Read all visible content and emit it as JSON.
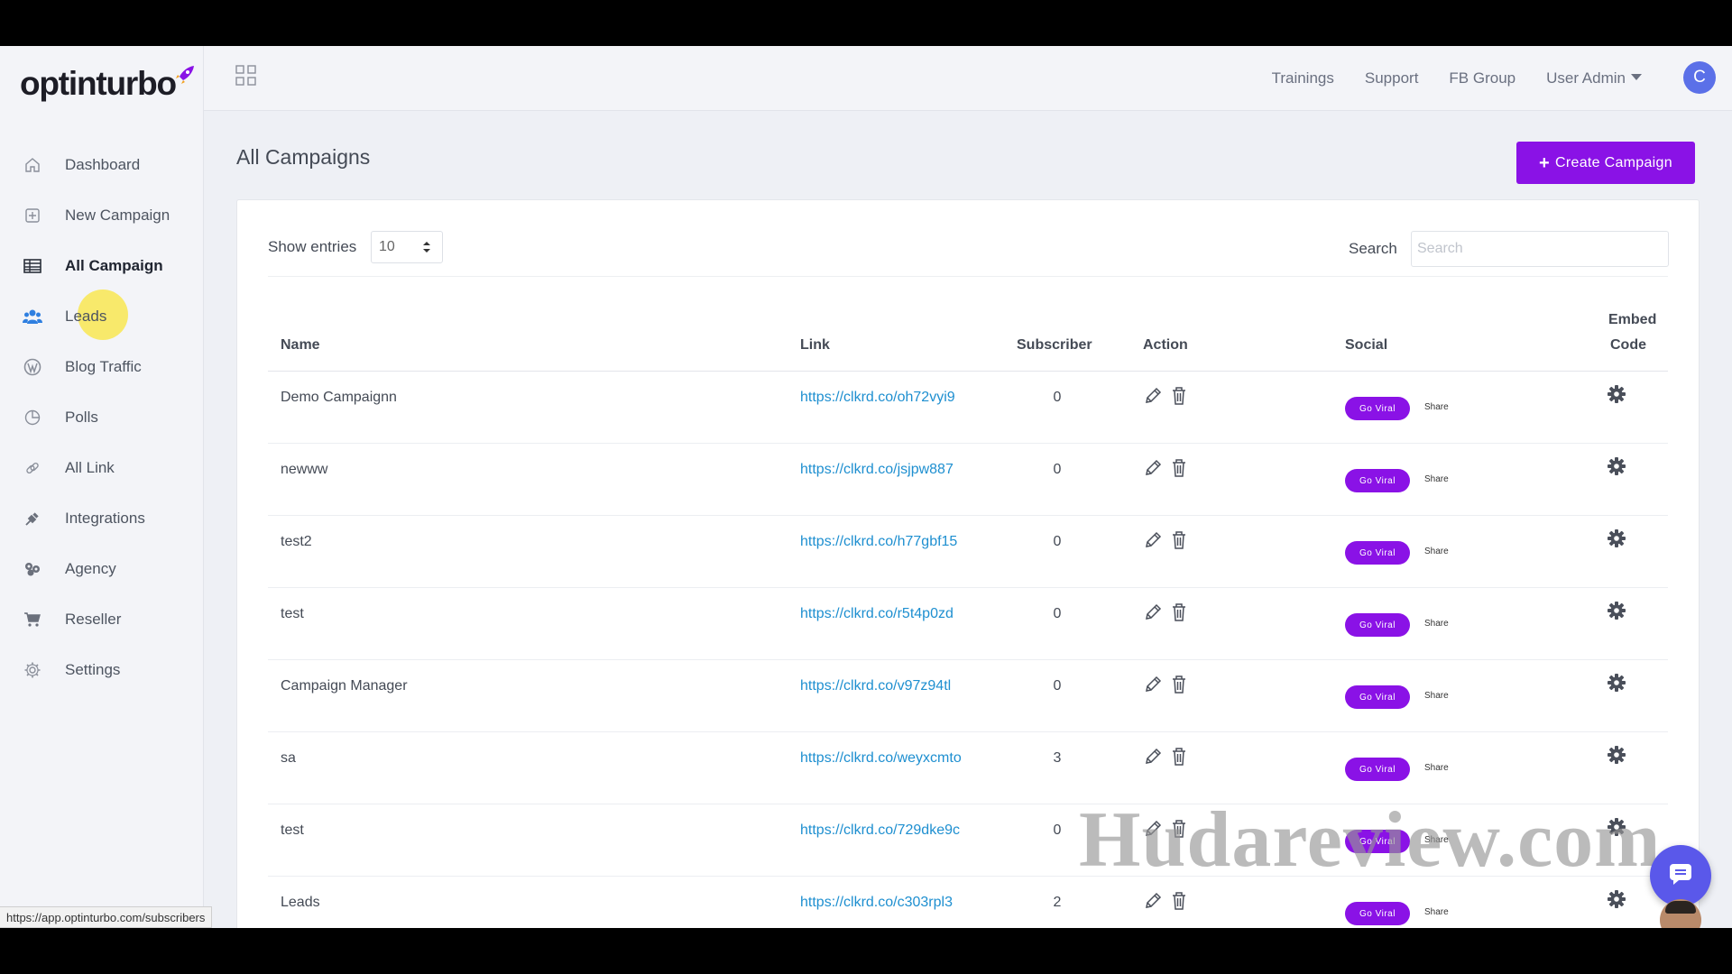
{
  "brand": {
    "logo_text": "optinturbo",
    "accent_color": "#8a12e6"
  },
  "sidebar": {
    "items": [
      {
        "label": "Dashboard",
        "icon": "home-icon"
      },
      {
        "label": "New Campaign",
        "icon": "plus-square-icon"
      },
      {
        "label": "All Campaign",
        "icon": "table-icon",
        "active": true
      },
      {
        "label": "Leads",
        "icon": "users-icon"
      },
      {
        "label": "Blog Traffic",
        "icon": "wordpress-icon"
      },
      {
        "label": "Polls",
        "icon": "pie-chart-icon"
      },
      {
        "label": "All Link",
        "icon": "link-icon"
      },
      {
        "label": "Integrations",
        "icon": "plug-icon"
      },
      {
        "label": "Agency",
        "icon": "agency-icon"
      },
      {
        "label": "Reseller",
        "icon": "cart-icon"
      },
      {
        "label": "Settings",
        "icon": "gear-icon"
      }
    ]
  },
  "topbar": {
    "links": [
      "Trainings",
      "Support",
      "FB Group"
    ],
    "user_menu": "User Admin",
    "avatar_initial": "C"
  },
  "page": {
    "title": "All Campaigns",
    "create_button": "Create Campaign"
  },
  "table_controls": {
    "show_entries_label": "Show entries",
    "entries_value": "10",
    "search_label": "Search",
    "search_placeholder": "Search"
  },
  "table": {
    "headers": {
      "name": "Name",
      "link": "Link",
      "subscriber": "Subscriber",
      "action": "Action",
      "social": "Social",
      "embed_line1": "Embed",
      "embed_line2": "Code"
    },
    "go_viral_label": "Go Viral",
    "share_label": "Share",
    "rows": [
      {
        "name": "Demo Campaignn",
        "link": "https://clkrd.co/oh72vyi9",
        "subscriber": "0"
      },
      {
        "name": "newww",
        "link": "https://clkrd.co/jsjpw887",
        "subscriber": "0"
      },
      {
        "name": "test2",
        "link": "https://clkrd.co/h77gbf15",
        "subscriber": "0"
      },
      {
        "name": "test",
        "link": "https://clkrd.co/r5t4p0zd",
        "subscriber": "0"
      },
      {
        "name": "Campaign Manager",
        "link": "https://clkrd.co/v97z94tl",
        "subscriber": "0"
      },
      {
        "name": "sa",
        "link": "https://clkrd.co/weyxcmto",
        "subscriber": "3"
      },
      {
        "name": "test",
        "link": "https://clkrd.co/729dke9c",
        "subscriber": "0"
      },
      {
        "name": "Leads",
        "link": "https://clkrd.co/c303rpl3",
        "subscriber": "2"
      }
    ]
  },
  "status_bar": {
    "url": "https://app.optinturbo.com/subscribers"
  },
  "watermark": "Hudareview.com"
}
